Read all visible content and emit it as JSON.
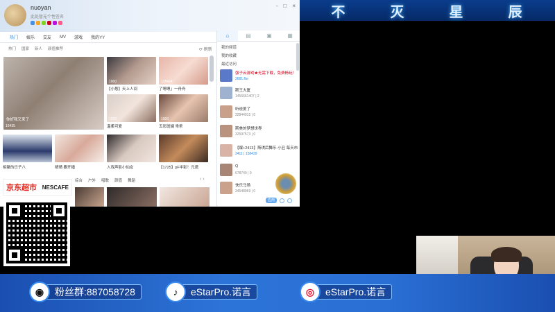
{
  "banner": {
    "chars": [
      "不",
      "灭",
      "星",
      "辰"
    ]
  },
  "app": {
    "username": "nuoyan",
    "signature": "此处暂无个性签名",
    "window_controls": [
      "-",
      "□",
      "×"
    ],
    "tabs": [
      "热门",
      "娱乐",
      "交友",
      "MV",
      "游戏",
      "我的YY"
    ],
    "subtabs": [
      "热门",
      "国家",
      "新人",
      "颜值推荐"
    ],
    "refresh_label": "刷新",
    "big_card": {
      "caption": "你好我又来了",
      "viewers": "16435"
    },
    "cards": [
      {
        "caption": "【小葱】天上人间",
        "stat": "1000"
      },
      {
        "caption": "了嗯嗯」一舟舟",
        "stat": "128424"
      },
      {
        "caption": "温柔可爱",
        "stat": "1000"
      },
      {
        "caption": "五彩斑斓 乖乖",
        "stat": "1000"
      },
      {
        "caption": "相聚的日子八",
        "stat": ""
      },
      {
        "caption": "晴晴 要开播",
        "stat": ""
      },
      {
        "caption": "入戏声影小仙女",
        "stat": ""
      },
      {
        "caption": "【1725】pF半影！元君",
        "stat": ""
      }
    ],
    "categories": [
      "综合",
      "户外",
      "唱歌",
      "颜值",
      "舞蹈"
    ],
    "ad": {
      "left": "京东超市",
      "right": "NESCAFE"
    }
  },
  "right_panel": {
    "tabs": [
      "home",
      "a",
      "b",
      "c"
    ],
    "sections": [
      "我的频道",
      "我的收藏",
      "最近访问"
    ],
    "channels": [
      {
        "name": "强子云游戏★无需下载，免费畅玩！",
        "stat": "2681.6w"
      },
      {
        "name": "斯王大厦",
        "stat": "1456661407 | 2"
      },
      {
        "name": "听说爱了",
        "stat": "32844015 | 0"
      },
      {
        "name": "斯美的梦想世界",
        "stat": "32597573 | 0"
      },
      {
        "name": "【爆+2413】斯琪后舞乐·小丑 每天市市",
        "stat": "3411 | 158439"
      },
      {
        "name": "Q",
        "stat": "678740 | 0"
      },
      {
        "name": "快乐马场",
        "stat": "34548969 | 0"
      }
    ],
    "footer_label": "应用"
  },
  "bottom_bar": {
    "fans_label": "粉丝群:887058728",
    "tiktok_label": "eStarPro.诺言",
    "weibo_label": "eStarPro.诺言"
  },
  "colors": {
    "accent": "#1f8cf0",
    "bar": "#2d74d8"
  }
}
